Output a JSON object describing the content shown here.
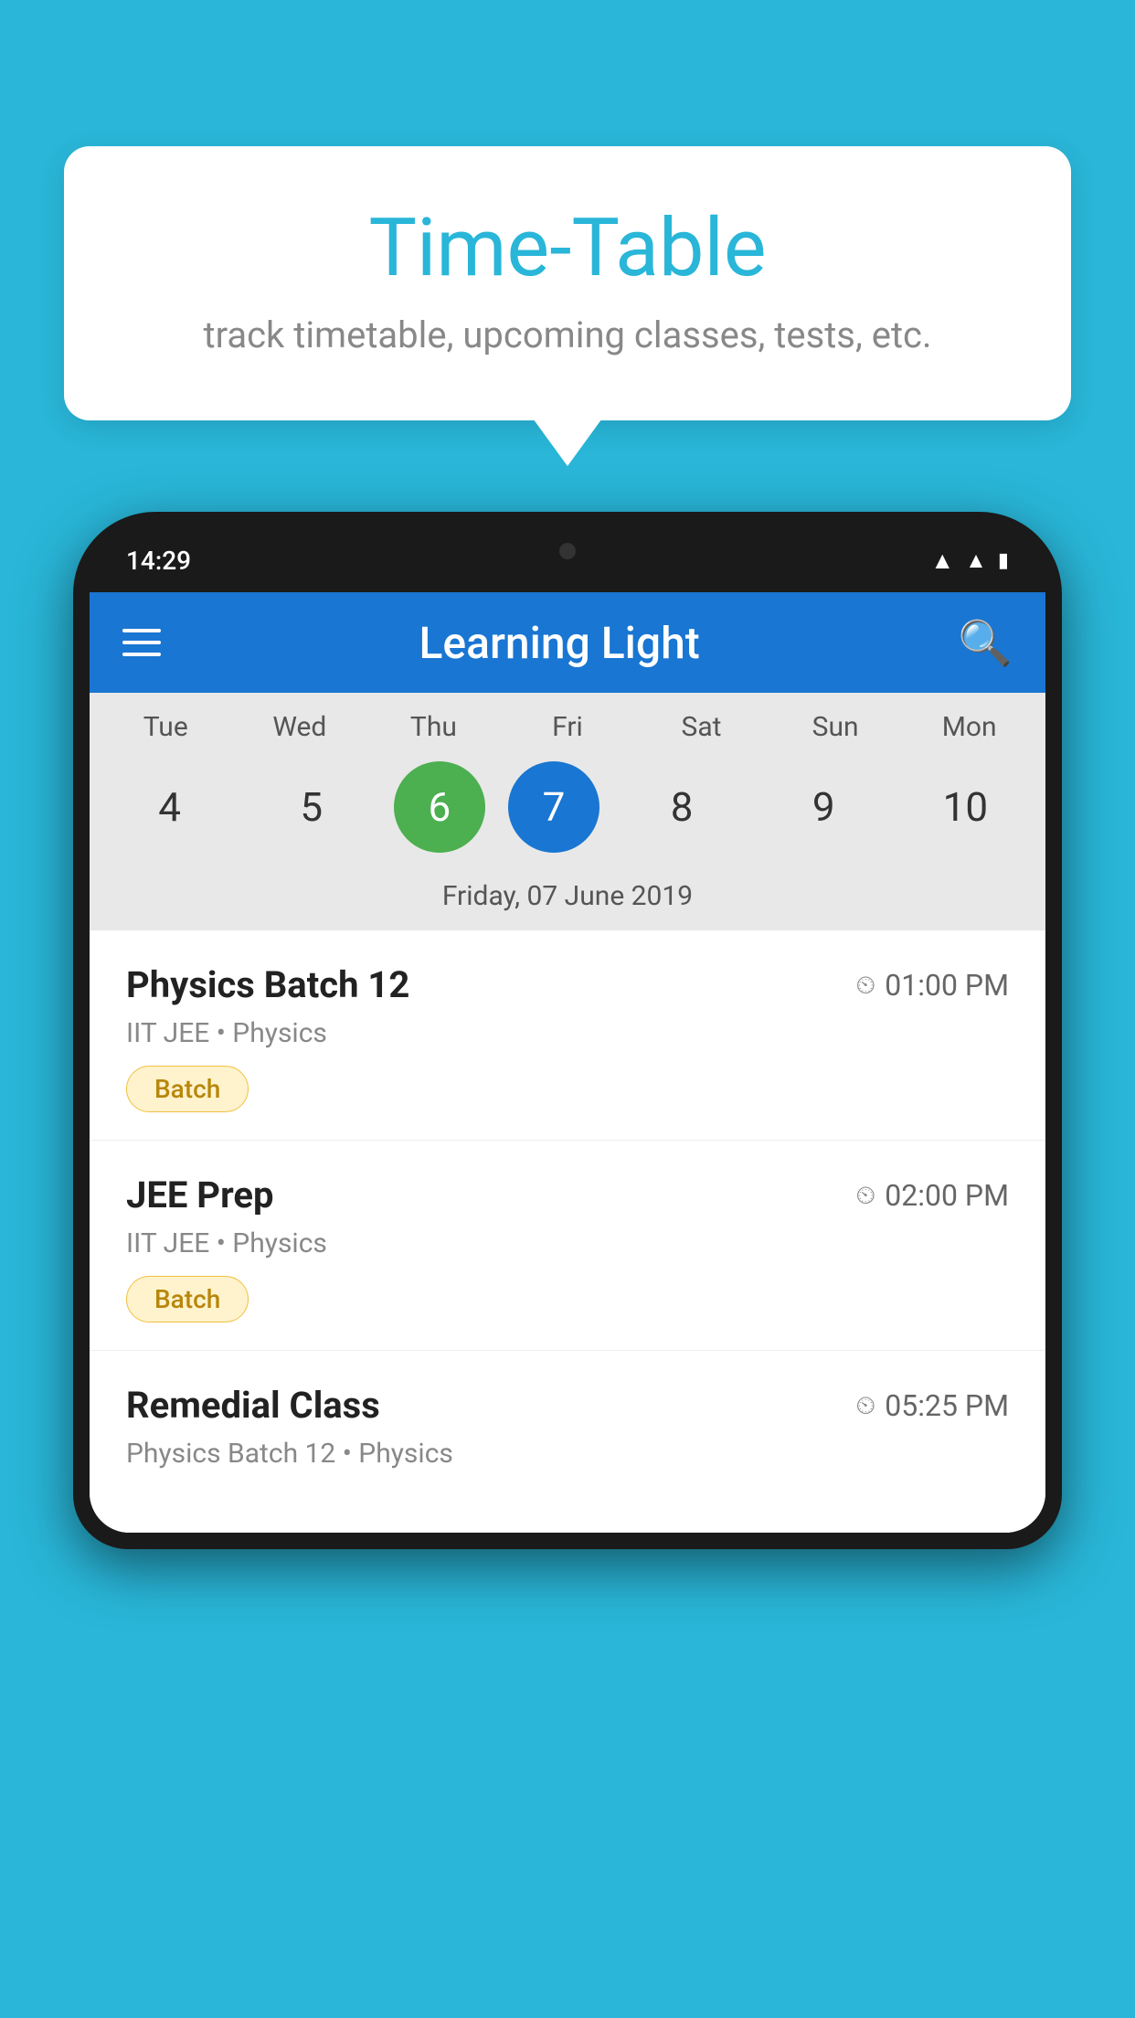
{
  "background_color": "#29b6d8",
  "bubble": {
    "title": "Time-Table",
    "subtitle": "track timetable, upcoming classes, tests, etc."
  },
  "phone": {
    "status_bar": {
      "time": "14:29"
    },
    "app_bar": {
      "title": "Learning Light"
    },
    "calendar": {
      "days": [
        {
          "label": "Tue",
          "number": "4",
          "state": "normal"
        },
        {
          "label": "Wed",
          "number": "5",
          "state": "normal"
        },
        {
          "label": "Thu",
          "number": "6",
          "state": "today"
        },
        {
          "label": "Fri",
          "number": "7",
          "state": "selected"
        },
        {
          "label": "Sat",
          "number": "8",
          "state": "normal"
        },
        {
          "label": "Sun",
          "number": "9",
          "state": "normal"
        },
        {
          "label": "Mon",
          "number": "10",
          "state": "normal"
        }
      ],
      "selected_date_label": "Friday, 07 June 2019"
    },
    "classes": [
      {
        "name": "Physics Batch 12",
        "time": "01:00 PM",
        "meta": "IIT JEE • Physics",
        "badge": "Batch"
      },
      {
        "name": "JEE Prep",
        "time": "02:00 PM",
        "meta": "IIT JEE • Physics",
        "badge": "Batch"
      },
      {
        "name": "Remedial Class",
        "time": "05:25 PM",
        "meta": "Physics Batch 12 • Physics",
        "badge": ""
      }
    ]
  }
}
